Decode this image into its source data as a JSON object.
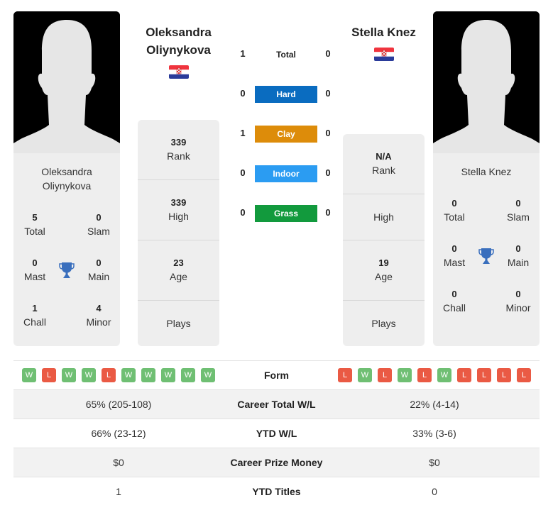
{
  "player1": {
    "name": "Oleksandra Oliynykova",
    "name_line1": "Oleksandra",
    "name_line2": "Oliynykova",
    "country_flag": "croatia-flag",
    "stats": {
      "total": {
        "value": "5",
        "label": "Total"
      },
      "slam": {
        "value": "0",
        "label": "Slam"
      },
      "mast": {
        "value": "0",
        "label": "Mast"
      },
      "main": {
        "value": "0",
        "label": "Main"
      },
      "chall": {
        "value": "1",
        "label": "Chall"
      },
      "minor": {
        "value": "4",
        "label": "Minor"
      }
    },
    "rank": {
      "value": "339",
      "label": "Rank"
    },
    "high": {
      "value": "339",
      "label": "High"
    },
    "age": {
      "value": "23",
      "label": "Age"
    },
    "plays": {
      "value": "",
      "label": "Plays"
    },
    "form": [
      "W",
      "L",
      "W",
      "W",
      "L",
      "W",
      "W",
      "W",
      "W",
      "W"
    ],
    "career_wl": "65% (205-108)",
    "ytd_wl": "66% (23-12)",
    "prize_money": "$0",
    "ytd_titles": "1"
  },
  "player2": {
    "name": "Stella Knez",
    "country_flag": "croatia-flag",
    "stats": {
      "total": {
        "value": "0",
        "label": "Total"
      },
      "slam": {
        "value": "0",
        "label": "Slam"
      },
      "mast": {
        "value": "0",
        "label": "Mast"
      },
      "main": {
        "value": "0",
        "label": "Main"
      },
      "chall": {
        "value": "0",
        "label": "Chall"
      },
      "minor": {
        "value": "0",
        "label": "Minor"
      }
    },
    "rank": {
      "value": "N/A",
      "label": "Rank"
    },
    "high": {
      "value": "",
      "label": "High"
    },
    "age": {
      "value": "19",
      "label": "Age"
    },
    "plays": {
      "value": "",
      "label": "Plays"
    },
    "form": [
      "L",
      "W",
      "L",
      "W",
      "L",
      "W",
      "L",
      "L",
      "L",
      "L"
    ],
    "career_wl": "22% (4-14)",
    "ytd_wl": "33% (3-6)",
    "prize_money": "$0",
    "ytd_titles": "0"
  },
  "h2h": [
    {
      "label": "Total",
      "p1": "1",
      "p2": "0",
      "color": null
    },
    {
      "label": "Hard",
      "p1": "0",
      "p2": "0",
      "color": "#0a6cc0"
    },
    {
      "label": "Clay",
      "p1": "1",
      "p2": "0",
      "color": "#dd8c0a"
    },
    {
      "label": "Indoor",
      "p1": "0",
      "p2": "0",
      "color": "#2b9cf2"
    },
    {
      "label": "Grass",
      "p1": "0",
      "p2": "0",
      "color": "#129a3d"
    }
  ],
  "comparison": {
    "form_label": "Form",
    "career_wl_label": "Career Total W/L",
    "ytd_wl_label": "YTD W/L",
    "prize_label": "Career Prize Money",
    "ytd_titles_label": "YTD Titles"
  },
  "colors": {
    "win": "#6fbf73",
    "loss": "#ea5a44",
    "trophy": "#3a6fbd"
  }
}
